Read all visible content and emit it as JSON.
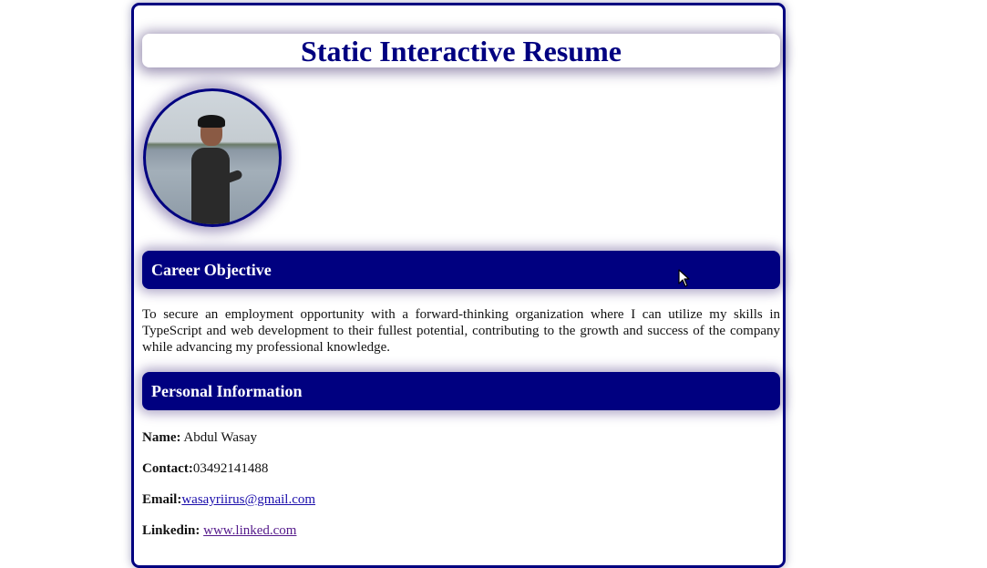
{
  "resume": {
    "title": "Static Interactive Resume",
    "career": {
      "heading": "Career Objective",
      "text": "To secure an employment opportunity with a forward-thinking organization where I can utilize my skills in TypeScript and web development to their fullest potential, contributing to the growth and success of the company while advancing my professional knowledge."
    },
    "personal": {
      "heading": "Personal Information",
      "name_label": "Name:",
      "name_value": "Abdul Wasay",
      "contact_label": "Contact:",
      "contact_value": "03492141488",
      "email_label": "Email:",
      "email_value": "wasayriirus@gmail.com",
      "linkedin_label": "Linkedin:",
      "linkedin_value": "www.linked.com"
    }
  },
  "colors": {
    "accent": "#000080",
    "link": "#1a0dab",
    "visited_link": "#551a8b"
  },
  "icons": {
    "avatar": "profile-photo",
    "cursor": "mouse-pointer-icon"
  }
}
